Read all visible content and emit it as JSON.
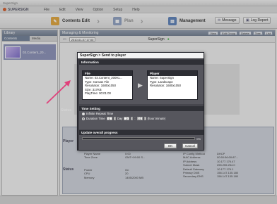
{
  "app": {
    "window_title": "SuperSign",
    "brand": "SUPERSIGN"
  },
  "menu": [
    "File",
    "Edit",
    "View",
    "Option",
    "Setup",
    "Help"
  ],
  "toolbar": {
    "steps": [
      "Contents Edit",
      "Plan",
      "Management"
    ],
    "buttons": [
      "Message",
      "Log Report"
    ]
  },
  "library": {
    "title": "Library",
    "tabs": [
      "Contents",
      "Media"
    ],
    "items": [
      {
        "label": "03.Content_20..."
      }
    ]
  },
  "main": {
    "title": "Managing & Monitoring",
    "header_buttons": [
      "View",
      "Edit Group",
      "Delete",
      "Tree",
      "List"
    ],
    "date": "2010-01-07 17:00",
    "player_tab": "SuperSign",
    "sections": {
      "status": "Status",
      "player": "Player",
      "status2": "Status"
    }
  },
  "detail": {
    "col1": [
      "Player Name",
      "Time Zone"
    ],
    "col2": [
      "0:00",
      "GMT+09:00 S..."
    ],
    "col3": [
      "IP Config Method",
      "MAC Address",
      "IP Address",
      "Subnet Mask",
      "Default Gateway",
      "Primary DNS",
      "Secondary DNS"
    ],
    "col4": [
      "DHCP",
      "00:50:56:00:87...",
      "10.177.176.47",
      "255.255.254.0",
      "10.177.176.1",
      "156.147.135.180",
      "156.147.135.180"
    ],
    "col1b": [
      "Power",
      "CPU",
      "Memory"
    ],
    "col2b": [
      "On",
      "20",
      "1405/2000 MB"
    ]
  },
  "dialog": {
    "title": "SuperSign > Send to player",
    "info_header": "Information",
    "file": {
      "header": "File",
      "lines": [
        "Name: 03.Content_20091...",
        "Type: Canvas File",
        "Resolution: 1680x1050",
        "Size: 317KB",
        "PlayTime: 00:01:00"
      ]
    },
    "player": {
      "header": "Player",
      "lines": [
        "Name: SuperSign",
        "Type: Landscape",
        "Resolution: 1680x1050"
      ]
    },
    "time_setting": {
      "header": "Time Setting",
      "option_infinite": "Infinite Repeat Time",
      "option_duration": "Duration Time",
      "day_value": "0",
      "day_label": "Day",
      "hour_value": "0",
      "minute_value": "10",
      "unit_label": "(hour:minute)"
    },
    "progress": {
      "header": "Update overall progress",
      "fraction": 0.0,
      "percent_label": "0%"
    },
    "ok_label": "OK",
    "cancel_label": "Cancel"
  }
}
